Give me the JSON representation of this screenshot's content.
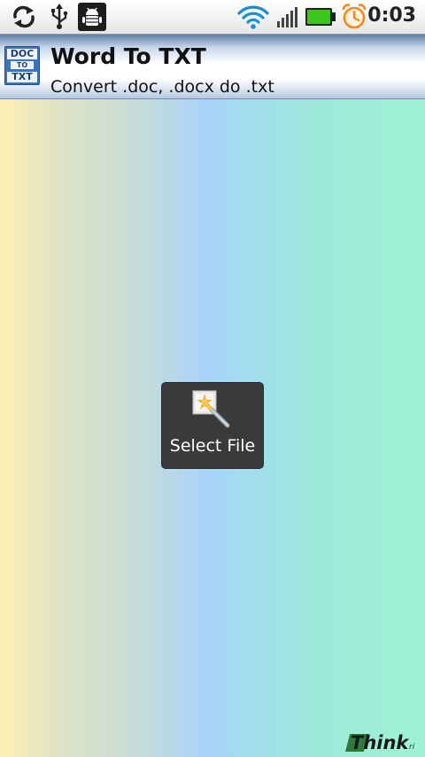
{
  "status_bar": {
    "time": "0:03",
    "icons": [
      "sync-icon",
      "usb-icon",
      "android-debug-icon",
      "wifi-icon",
      "signal-icon",
      "battery-icon",
      "alarm-icon"
    ]
  },
  "title_bar": {
    "icon_lines": [
      "DOC",
      "TO",
      "TXT"
    ],
    "title": "Word To TXT",
    "subtitle": "Convert .doc, .docx do .txt"
  },
  "main": {
    "select_button_label": "Select File",
    "select_button_icon": "magic-wand-icon"
  },
  "branding": {
    "text": "Think",
    "suffix": "ri"
  },
  "colors": {
    "battery": "#3ec51e",
    "wifi": "#1a8fd0",
    "alarm": "#f08a1c",
    "button_bg": "#3a3a3a",
    "brand_green": "#2d7a3c"
  }
}
